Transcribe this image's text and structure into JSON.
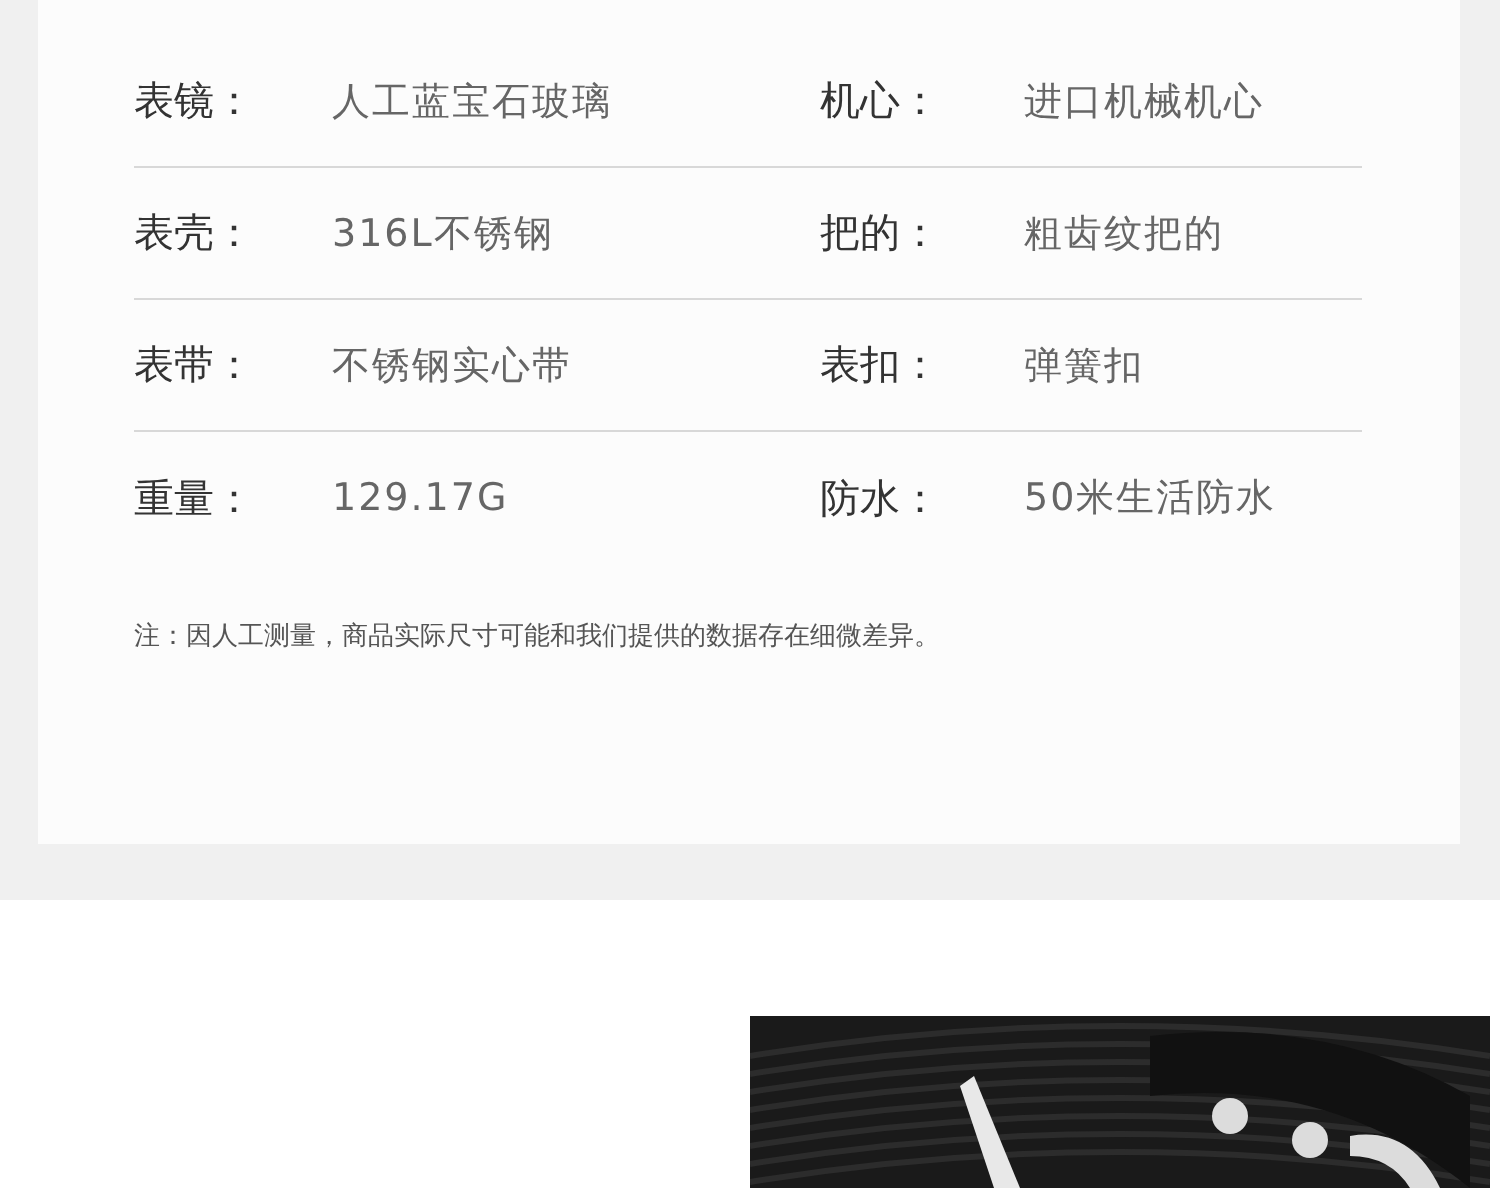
{
  "specs": [
    [
      {
        "label": "表镜：",
        "value": "人工蓝宝石玻璃"
      },
      {
        "label": "机心：",
        "value": "进口机械机心"
      }
    ],
    [
      {
        "label": "表壳：",
        "value": "316L不锈钢"
      },
      {
        "label": "把的：",
        "value": "粗齿纹把的"
      }
    ],
    [
      {
        "label": "表带：",
        "value": "不锈钢实心带"
      },
      {
        "label": "表扣：",
        "value": "弹簧扣"
      }
    ],
    [
      {
        "label": "重量：",
        "value": "129.17G"
      },
      {
        "label": "防水：",
        "value": "50米生活防水"
      }
    ]
  ],
  "note": "注：因人工测量，商品实际尺寸可能和我们提供的数据存在细微差异。"
}
